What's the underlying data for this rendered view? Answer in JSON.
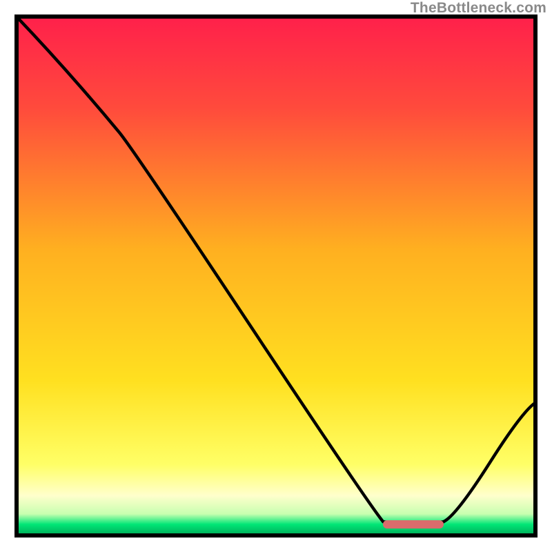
{
  "watermark": "TheBottleneck.com",
  "colors": {
    "top": "#ff1f4b",
    "mid": "#ffd020",
    "pale": "#ffffaa",
    "green": "#00e676",
    "green_deep": "#009e52",
    "curve": "#000000",
    "marker": "#d96c6c"
  },
  "marker": {
    "x_start": 0.705,
    "x_end": 0.82,
    "y": 0.975
  },
  "chart_data": {
    "type": "line",
    "title": "",
    "xlabel": "",
    "ylabel": "",
    "xlim": [
      0,
      1
    ],
    "ylim": [
      0,
      1
    ],
    "series": [
      {
        "name": "curve",
        "points": [
          {
            "x": 0.0,
            "y": 1.0
          },
          {
            "x": 0.2,
            "y": 0.775
          },
          {
            "x": 0.705,
            "y": 0.03
          },
          {
            "x": 0.82,
            "y": 0.03
          },
          {
            "x": 1.0,
            "y": 0.26
          }
        ]
      }
    ],
    "optimum_band_x": [
      0.705,
      0.82
    ]
  }
}
